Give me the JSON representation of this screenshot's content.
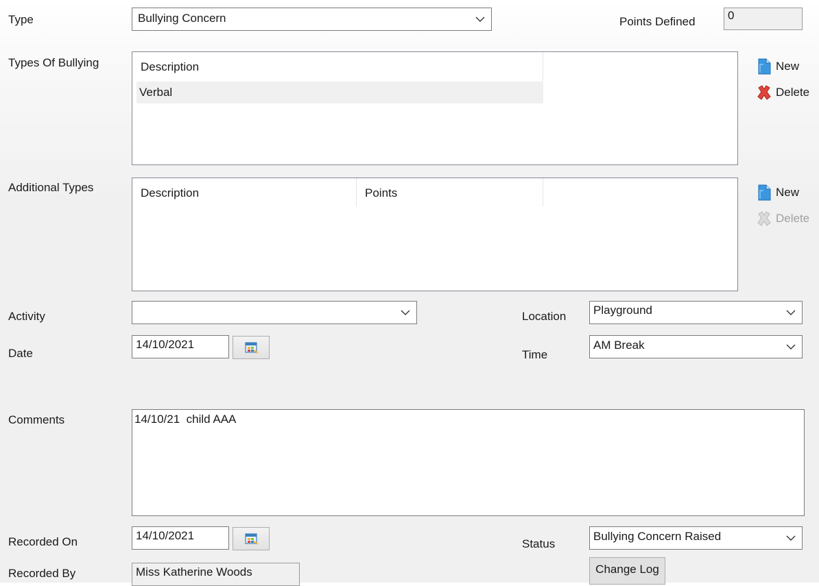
{
  "type": {
    "label": "Type",
    "value": "Bullying Concern"
  },
  "points_defined": {
    "label": "Points Defined",
    "value": "0"
  },
  "types_of_bullying": {
    "label": "Types Of Bullying",
    "columns": [
      "Description"
    ],
    "rows": [
      "Verbal"
    ],
    "new_label": "New",
    "delete_label": "Delete"
  },
  "additional_types": {
    "label": "Additional Types",
    "columns": [
      "Description",
      "Points"
    ],
    "rows": [],
    "new_label": "New",
    "delete_label": "Delete",
    "delete_enabled": false
  },
  "activity": {
    "label": "Activity",
    "value": ""
  },
  "location": {
    "label": "Location",
    "value": "Playground"
  },
  "date": {
    "label": "Date",
    "value": "14/10/2021"
  },
  "time": {
    "label": "Time",
    "value": "AM Break"
  },
  "comments": {
    "label": "Comments",
    "value": "14/10/21  child AAA"
  },
  "recorded_on": {
    "label": "Recorded On",
    "value": "14/10/2021"
  },
  "status": {
    "label": "Status",
    "value": "Bullying Concern Raised"
  },
  "recorded_by": {
    "label": "Recorded By",
    "value": "Miss Katherine Woods"
  },
  "change_log": {
    "label": "Change Log"
  },
  "icons": {
    "dropdown": "chevron-down-icon",
    "calendar": "calendar-icon",
    "new": "new-document-icon",
    "delete": "delete-x-icon"
  },
  "colors": {
    "delete_active": "#d9362b",
    "new_icon": "#2f8fd8",
    "readonly_bg": "#f0f0f0",
    "selected_row": "#f0f0f0"
  }
}
